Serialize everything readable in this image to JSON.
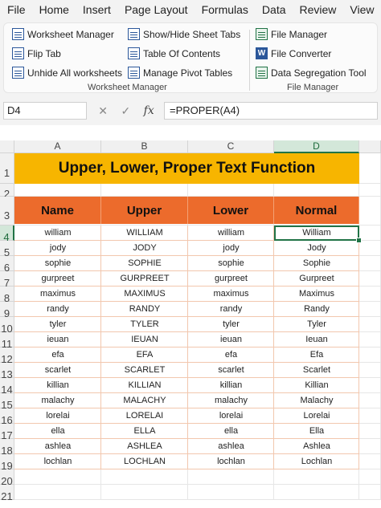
{
  "menu": [
    "File",
    "Home",
    "Insert",
    "Page Layout",
    "Formulas",
    "Data",
    "Review",
    "View"
  ],
  "ribbon": {
    "worksheet_manager": {
      "buttons": [
        "Worksheet Manager",
        "Show/Hide Sheet Tabs",
        "Flip Tab",
        "Table Of Contents",
        "Unhide All worksheets",
        "Manage Pivot Tables"
      ],
      "label": "Worksheet Manager"
    },
    "file_manager": {
      "buttons": [
        "File Manager",
        "File Converter",
        "Data Segregation Tool"
      ],
      "label": "File Manager"
    }
  },
  "formula_bar": {
    "name_box": "D4",
    "cancel": "✕",
    "enter": "✓",
    "fx": "fx",
    "formula": "=PROPER(A4)"
  },
  "sheet": {
    "columns": [
      "A",
      "B",
      "C",
      "D"
    ],
    "selected_column": "D",
    "selected_row": "4",
    "rows": [
      "1",
      "2",
      "3",
      "4",
      "5",
      "6",
      "7",
      "8",
      "9",
      "10",
      "11",
      "12",
      "13",
      "14",
      "15",
      "16",
      "17",
      "18",
      "19",
      "20",
      "21"
    ],
    "title": "Upper, Lower, Proper Text Function",
    "headers": [
      "Name",
      "Upper",
      "Lower",
      "Normal"
    ],
    "data": [
      [
        "william",
        "WILLIAM",
        "william",
        "William"
      ],
      [
        "jody",
        "JODY",
        "jody",
        "Jody"
      ],
      [
        "sophie",
        "SOPHIE",
        "sophie",
        "Sophie"
      ],
      [
        "gurpreet",
        "GURPREET",
        "gurpreet",
        "Gurpreet"
      ],
      [
        "maximus",
        "MAXIMUS",
        "maximus",
        "Maximus"
      ],
      [
        "randy",
        "RANDY",
        "randy",
        "Randy"
      ],
      [
        "tyler",
        "TYLER",
        "tyler",
        "Tyler"
      ],
      [
        "ieuan",
        "IEUAN",
        "ieuan",
        "Ieuan"
      ],
      [
        "efa",
        "EFA",
        "efa",
        "Efa"
      ],
      [
        "scarlet",
        "SCARLET",
        "scarlet",
        "Scarlet"
      ],
      [
        "killian",
        "KILLIAN",
        "killian",
        "Killian"
      ],
      [
        "malachy",
        "MALACHY",
        "malachy",
        "Malachy"
      ],
      [
        "lorelai",
        "LORELAI",
        "lorelai",
        "Lorelai"
      ],
      [
        "ella",
        "ELLA",
        "ella",
        "Ella"
      ],
      [
        "ashlea",
        "ASHLEA",
        "ashlea",
        "Ashlea"
      ],
      [
        "lochlan",
        "LOCHLAN",
        "lochlan",
        "Lochlan"
      ]
    ]
  },
  "colors": {
    "title_fill": "#f7b500",
    "header_fill": "#ec6b2c",
    "selection": "#217346"
  }
}
